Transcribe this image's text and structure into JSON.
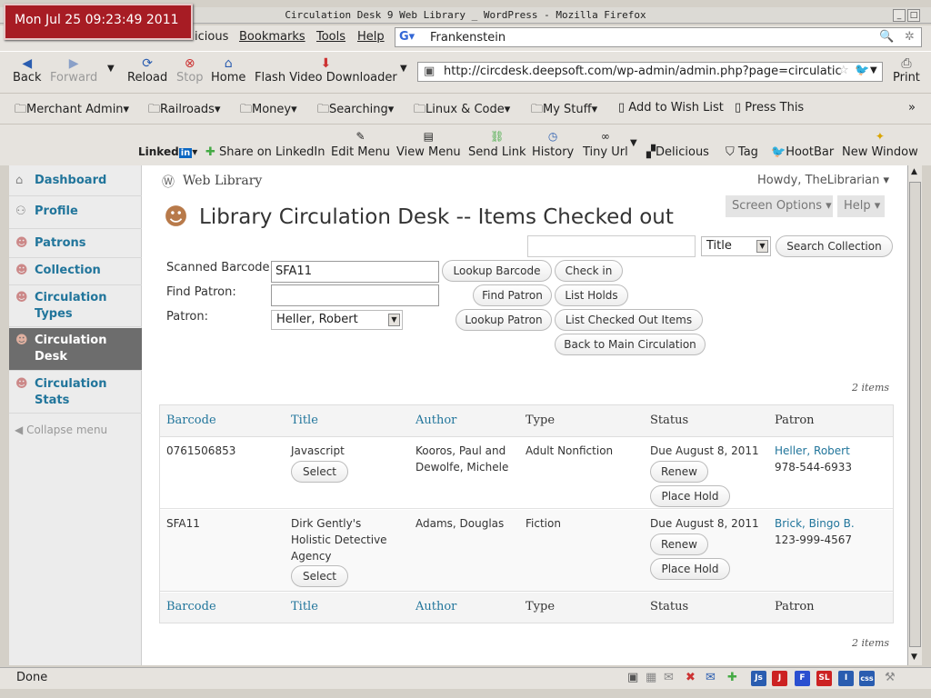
{
  "clock": "Mon Jul 25 09:23:49 2011",
  "window_title": "Circulation Desk  9 Web Library  _ WordPress - Mozilla Firefox",
  "menu": {
    "history_partial": "icious",
    "bookmarks": "Bookmarks",
    "tools": "Tools",
    "help": "Help"
  },
  "search_engine_value": "Frankenstein",
  "nav": {
    "back": "Back",
    "forward": "Forward",
    "reload": "Reload",
    "stop": "Stop",
    "home": "Home",
    "flash": "Flash Video Downloader",
    "print": "Print"
  },
  "url": "http://circdesk.deepsoft.com/wp-admin/admin.php?page=circulatic",
  "bookmarks": [
    "Merchant Admin",
    "Railroads",
    "Money",
    "Searching",
    "Linux & Code",
    "My Stuff",
    "Add to Wish List",
    "Press This"
  ],
  "toolbar": {
    "linkedin": "Linked",
    "share": "Share on LinkedIn",
    "edit_menu": "Edit Menu",
    "view_menu": "View Menu",
    "send_link": "Send Link",
    "history": "History",
    "tiny_url": "Tiny Url",
    "delicious": "Delicious",
    "tag": "Tag",
    "hootbar": "HootBar",
    "new_window": "New Window"
  },
  "sidebar": {
    "items": [
      {
        "label": "Dashboard"
      },
      {
        "label": "Profile"
      },
      {
        "label": "Patrons"
      },
      {
        "label": "Collection"
      },
      {
        "label": "Circulation Types"
      },
      {
        "label": "Circulation Desk"
      },
      {
        "label": "Circulation Stats"
      }
    ],
    "collapse": "Collapse menu"
  },
  "header": {
    "site": "Web Library",
    "howdy": "Howdy, TheLibrarian",
    "screen_options": "Screen Options",
    "help": "Help",
    "page_title": "Library Circulation Desk -- Items Checked out"
  },
  "search": {
    "value": "",
    "field": "Title",
    "button": "Search Collection"
  },
  "form": {
    "scanned_barcode_label": "Scanned Barcode",
    "scanned_barcode_value": "SFA11",
    "find_patron_label": "Find Patron:",
    "find_patron_value": "",
    "patron_label": "Patron:",
    "patron_value": "Heller, Robert",
    "lookup_barcode": "Lookup Barcode",
    "check_in": "Check in",
    "find_patron_btn": "Find Patron",
    "list_holds": "List Holds",
    "lookup_patron": "Lookup Patron",
    "list_checked_out": "List Checked Out Items",
    "back_main": "Back to Main Circulation"
  },
  "items_count": "2 items",
  "table": {
    "headers": [
      "Barcode",
      "Title",
      "Author",
      "Type",
      "Status",
      "Patron"
    ],
    "rows": [
      {
        "barcode": "0761506853",
        "title": "Javascript",
        "author_line1": "Kooros, Paul and",
        "author_line2": "Dewolfe, Michele",
        "type": "Adult Nonfiction",
        "status": "Due August 8, 2011",
        "patron": "Heller, Robert",
        "phone": "978-544-6933"
      },
      {
        "barcode": "SFA11",
        "title_line1": "Dirk Gently's",
        "title_line2": "Holistic Detective",
        "title_line3": "Agency",
        "author": "Adams, Douglas",
        "type": "Fiction",
        "status": "Due August 8, 2011",
        "patron": "Brick, Bingo B.",
        "phone": "123-999-4567"
      }
    ],
    "select": "Select",
    "renew": "Renew",
    "place_hold": "Place Hold"
  },
  "status_text": "Done",
  "status_icons": [
    "Js",
    "J",
    "F",
    "SL",
    "I",
    "css"
  ]
}
